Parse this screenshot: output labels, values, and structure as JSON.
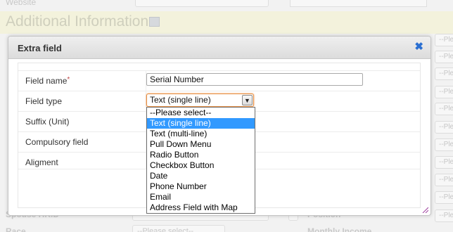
{
  "background": {
    "website_label": "Website",
    "section_title": "Additional Information",
    "right_placeholder": "--Please select--",
    "spouse_label": "Spouse HKID",
    "position_label": "Position",
    "race_label": "Race",
    "race_value": "--Please select--",
    "monthly_income_label": "Monthly Income"
  },
  "dialog": {
    "title": "Extra field",
    "close_icon": "close-icon",
    "fields": {
      "field_name_label": "Field name",
      "required_mark": "*",
      "field_name_value": "Serial Number",
      "field_type_label": "Field type",
      "field_type_value": "Text (single line)",
      "suffix_label": "Suffix (Unit)",
      "compulsory_label": "Compulsory field",
      "alignment_label": "Aligment"
    }
  },
  "dropdown": {
    "options": [
      "--Please select--",
      "Text (single line)",
      "Text (multi-line)",
      "Pull Down Menu",
      "Radio Button",
      "Checkbox Button",
      "Date",
      "Phone Number",
      "Email",
      "Address Field with Map"
    ],
    "selected_index": 1
  },
  "colors": {
    "accent": "#3199ff",
    "close": "#2a6fd1",
    "focus": "#e58c3f"
  }
}
